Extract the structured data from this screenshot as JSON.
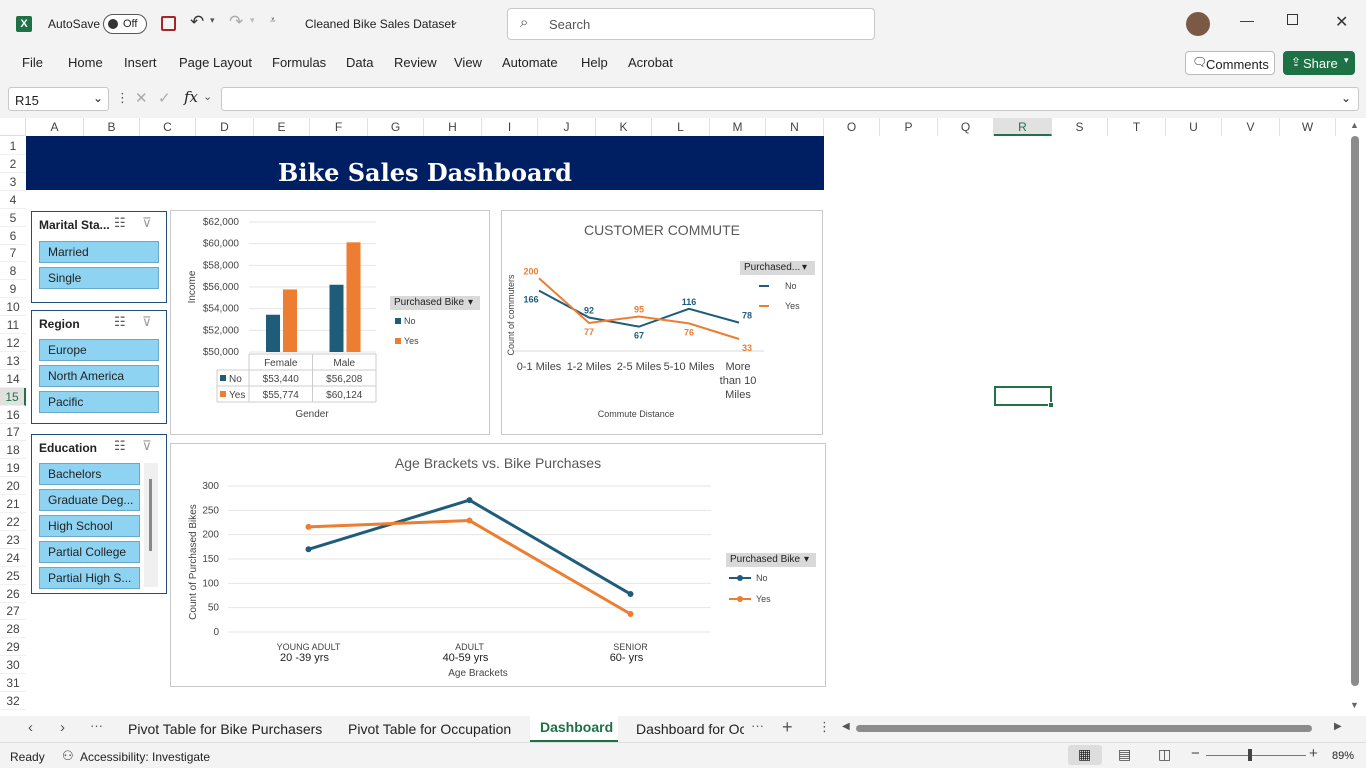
{
  "app": {
    "autosave": "AutoSave",
    "autosave_state": "Off",
    "title": "Cleaned Bike Sales Dataset",
    "search_placeholder": "Search"
  },
  "menu": [
    "File",
    "Home",
    "Insert",
    "Page Layout",
    "Formulas",
    "Data",
    "Review",
    "View",
    "Automate",
    "Help",
    "Acrobat"
  ],
  "ribbon_right": {
    "comments": "Comments",
    "share": "Share"
  },
  "formula": {
    "namebox": "R15",
    "fx": "fx",
    "value": ""
  },
  "columns": [
    "A",
    "B",
    "C",
    "D",
    "E",
    "F",
    "G",
    "H",
    "I",
    "J",
    "K",
    "L",
    "M",
    "N",
    "O",
    "P",
    "Q",
    "R",
    "S",
    "T",
    "U",
    "V",
    "W"
  ],
  "rows": [
    "1",
    "2",
    "3",
    "4",
    "5",
    "6",
    "7",
    "8",
    "9",
    "10",
    "11",
    "12",
    "13",
    "14",
    "15",
    "16",
    "17",
    "18",
    "19",
    "20",
    "21",
    "22",
    "23",
    "24",
    "25",
    "26",
    "27",
    "28",
    "29",
    "30",
    "31",
    "32"
  ],
  "dashboard_title": "Bike Sales Dashboard",
  "slicers": {
    "marital": {
      "title": "Marital Sta...",
      "items": [
        "Married",
        "Single"
      ]
    },
    "region": {
      "title": "Region",
      "items": [
        "Europe",
        "North America",
        "Pacific"
      ]
    },
    "education": {
      "title": "Education",
      "items": [
        "Bachelors",
        "Graduate Deg...",
        "High School",
        "Partial College",
        "Partial High S..."
      ]
    }
  },
  "chart_data": [
    {
      "type": "bar",
      "title": "",
      "categories": [
        "Female",
        "Male"
      ],
      "series": [
        {
          "name": "No",
          "values": [
            53440,
            56208
          ],
          "labels": [
            "$53,440",
            "$56,208"
          ],
          "color": "#1f5c7a"
        },
        {
          "name": "Yes",
          "values": [
            55774,
            60124
          ],
          "labels": [
            "$55,774",
            "$60,124"
          ],
          "color": "#ed7d31"
        }
      ],
      "xlabel": "Gender",
      "ylabel": "Income",
      "ylim": [
        50000,
        62000
      ],
      "yticks": [
        "$50,000",
        "$52,000",
        "$54,000",
        "$56,000",
        "$58,000",
        "$60,000",
        "$62,000"
      ],
      "legend_title": "Purchased Bike",
      "legend": "right"
    },
    {
      "type": "line",
      "title": "CUSTOMER COMMUTE",
      "categories": [
        "0-1 Miles",
        "1-2 Miles",
        "2-5 Miles",
        "5-10 Miles",
        "More than 10 Miles"
      ],
      "series": [
        {
          "name": "No",
          "values": [
            166,
            92,
            67,
            116,
            78
          ],
          "color": "#1f5c7a"
        },
        {
          "name": "Yes",
          "values": [
            200,
            77,
            95,
            76,
            33
          ],
          "color": "#ed7d31"
        }
      ],
      "xlabel": "Commute Distance",
      "ylabel": "Count of commuters",
      "legend_title": "Purchased...",
      "legend": "right"
    },
    {
      "type": "line",
      "title": "Age Brackets vs. Bike Purchases",
      "categories": [
        "YOUNG ADULT",
        "ADULT",
        "SENIOR"
      ],
      "category_sub": [
        "20 -39 yrs",
        "40-59 yrs",
        "60- yrs"
      ],
      "series": [
        {
          "name": "No",
          "values": [
            170,
            271,
            78
          ],
          "color": "#1f5c7a"
        },
        {
          "name": "Yes",
          "values": [
            216,
            229,
            37
          ],
          "color": "#ed7d31"
        }
      ],
      "xlabel": "Age Brackets",
      "ylabel": "Count of Purchased Bikes",
      "ylim": [
        0,
        300
      ],
      "yticks": [
        "0",
        "50",
        "100",
        "150",
        "200",
        "250",
        "300"
      ],
      "legend_title": "Purchased Bike",
      "legend": "right"
    }
  ],
  "sheet_tabs": [
    "Pivot Table for Bike Purchasers",
    "Pivot Table for Occupation",
    "Dashboard",
    "Dashboard for Oc"
  ],
  "active_tab": "Dashboard",
  "status": {
    "ready": "Ready",
    "accessibility": "Accessibility: Investigate",
    "zoom": "89%"
  }
}
